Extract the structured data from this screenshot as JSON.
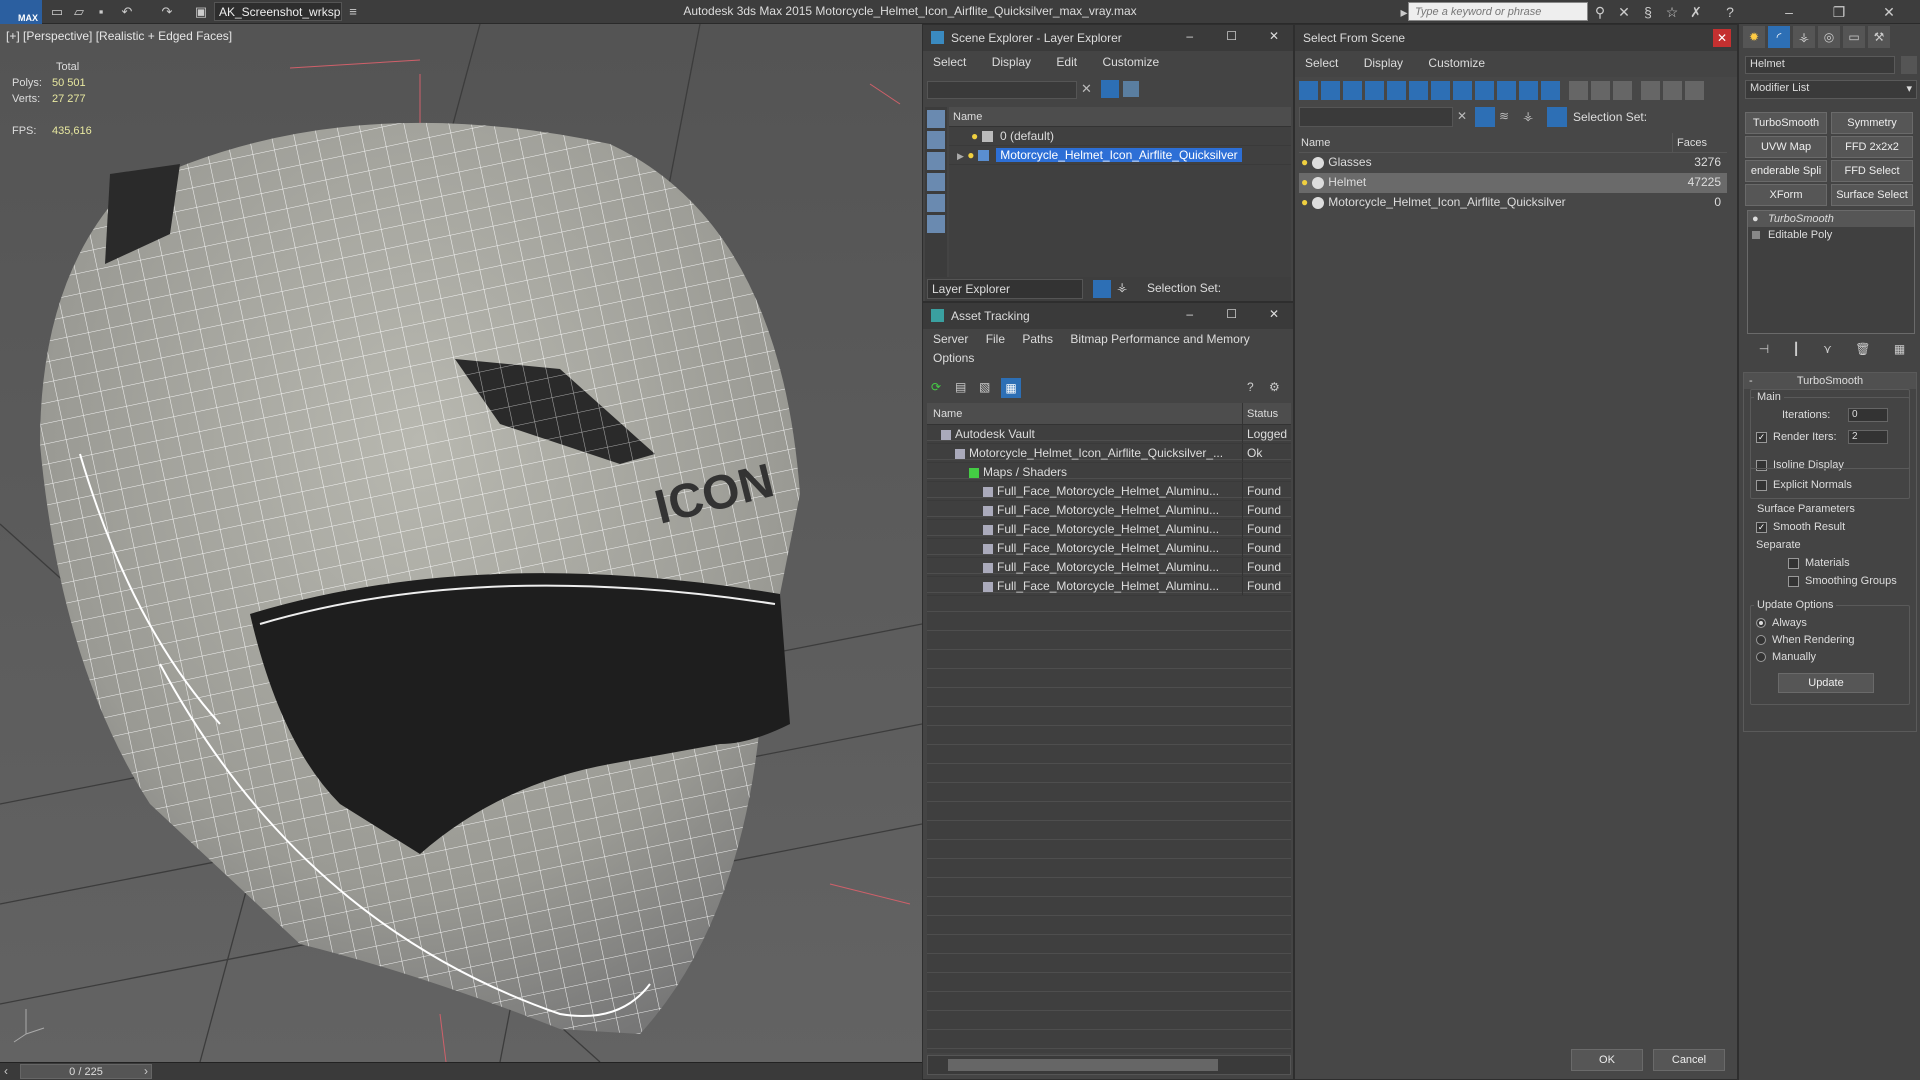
{
  "titlebar": {
    "logo": "MAX",
    "workspace": "AK_Screenshot_wrksp",
    "app_title": "Autodesk 3ds Max  2015    Motorcycle_Helmet_Icon_Airflite_Quicksilver_max_vray.max",
    "search_placeholder": "Type a keyword or phrase"
  },
  "viewport": {
    "label": "[+] [Perspective] [Realistic + Edged Faces]",
    "stats_total": "Total",
    "polys_label": "Polys:",
    "polys_value": "50 501",
    "verts_label": "Verts:",
    "verts_value": "27 277",
    "fps_label": "FPS:",
    "fps_value": "435,616",
    "brand_text": "ICON"
  },
  "timeline": {
    "frame": "0 / 225"
  },
  "scene_explorer": {
    "title": "Scene Explorer - Layer Explorer",
    "menu": [
      "Select",
      "Display",
      "Edit",
      "Customize"
    ],
    "column": "Name",
    "rows": [
      "0 (default)",
      "Motorcycle_Helmet_Icon_Airflite_Quicksilver"
    ],
    "footer_dropdown": "Layer Explorer",
    "footer_selset": "Selection Set:"
  },
  "asset_tracking": {
    "title": "Asset Tracking",
    "menu": [
      "Server",
      "File",
      "Paths",
      "Bitmap Performance and Memory"
    ],
    "menu2": "Options",
    "col_name": "Name",
    "col_status": "Status",
    "rows": [
      {
        "name": "Autodesk Vault",
        "status": "Logged",
        "indent": 0
      },
      {
        "name": "Motorcycle_Helmet_Icon_Airflite_Quicksilver_...",
        "status": "Ok",
        "indent": 1
      },
      {
        "name": "Maps / Shaders",
        "status": "",
        "indent": 2
      },
      {
        "name": "Full_Face_Motorcycle_Helmet_Aluminu...",
        "status": "Found",
        "indent": 3
      },
      {
        "name": "Full_Face_Motorcycle_Helmet_Aluminu...",
        "status": "Found",
        "indent": 3
      },
      {
        "name": "Full_Face_Motorcycle_Helmet_Aluminu...",
        "status": "Found",
        "indent": 3
      },
      {
        "name": "Full_Face_Motorcycle_Helmet_Aluminu...",
        "status": "Found",
        "indent": 3
      },
      {
        "name": "Full_Face_Motorcycle_Helmet_Aluminu...",
        "status": "Found",
        "indent": 3
      },
      {
        "name": "Full_Face_Motorcycle_Helmet_Aluminu...",
        "status": "Found",
        "indent": 3
      }
    ]
  },
  "select_from_scene": {
    "title": "Select From Scene",
    "menu": [
      "Select",
      "Display",
      "Customize"
    ],
    "selset": "Selection Set:",
    "col_name": "Name",
    "col_faces": "Faces",
    "rows": [
      {
        "name": "Glasses",
        "faces": "3276"
      },
      {
        "name": "Helmet",
        "faces": "47225"
      },
      {
        "name": "Motorcycle_Helmet_Icon_Airflite_Quicksilver",
        "faces": "0"
      }
    ],
    "ok": "OK",
    "cancel": "Cancel"
  },
  "command_panel": {
    "object_name": "Helmet",
    "modifier_list": "Modifier List",
    "buttons": [
      "TurboSmooth",
      "Symmetry",
      "UVW Map",
      "FFD 2x2x2",
      "enderable Spli",
      "FFD Select",
      "XForm",
      "Surface Select"
    ],
    "stack": [
      "TurboSmooth",
      "Editable Poly"
    ],
    "rollout_title": "TurboSmooth",
    "main": "Main",
    "iterations_label": "Iterations:",
    "iterations": "0",
    "render_iters_label": "Render Iters:",
    "render_iters": "2",
    "isoline": "Isoline Display",
    "explicit": "Explicit Normals",
    "surface_params": "Surface Parameters",
    "smooth_result": "Smooth Result",
    "separate": "Separate",
    "materials": "Materials",
    "smoothing_groups": "Smoothing Groups",
    "update_options": "Update Options",
    "always": "Always",
    "when_rendering": "When Rendering",
    "manually": "Manually",
    "update": "Update"
  }
}
